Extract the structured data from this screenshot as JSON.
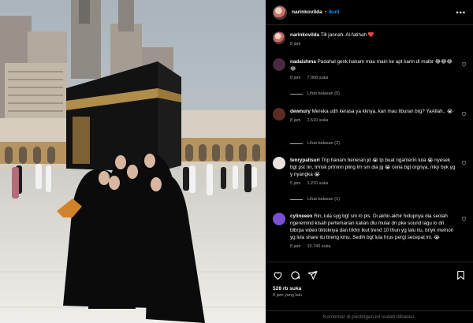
{
  "post": {
    "username": "narinkovilda",
    "follow_label": "Ikuti",
    "separator": "•",
    "more_label": "•••",
    "caption": {
      "username": "narinkovilda",
      "text": "Till jannah. Al-fatihah",
      "emoji": "❤️",
      "time": "8 jam"
    },
    "likes": "528 rb suka",
    "posted": "8 jam yang lalu",
    "comments_disabled": "Komentar di postingan ini sudah dibatasi."
  },
  "comments": [
    {
      "username": "nadaishma",
      "text": "Padahal genk hanam mau main ke apt karin di malbr 😂😂😂😂",
      "time": "8 jam",
      "likes": "7.068 suka",
      "replies": "Lihat balasan (5)",
      "avatar_color": "#4a2a3c"
    },
    {
      "username": "dewnury",
      "text": "Mereka udh kerasa ya kknya, kan mau liburan brg? YaAllah.. 😭",
      "time": "8 jam",
      "likes": "1.510 suka",
      "replies": "Lihat balasan (2)",
      "avatar_color": "#5c2c24"
    },
    {
      "username": "tenrypalisuri",
      "text": "Trip hanam beneran jd 😭 tp buat nganterin lula 😭 nyesek bgt pst rin, trmsk prtmnn pling lm sm dia jg 😭 ceria bgt orgnya, mky byk yg y nyangka 😭",
      "time": "5 jam",
      "likes": "1.210 suka",
      "replies": "Lihat balasan (1)",
      "avatar_color": "#e9e1dc"
    },
    {
      "username": "cylineeex",
      "text": "Rin, lula syg bgt sm lo pls. Di akhir-akhir hidupnya dia seolah ngeremind kisah pertemanan kalian dlu mulai dri pke sound lagu lo dri blbrpa video tiktoknya dan trkhir ikut trend 10 thun yg lalu itu, bnyk memori yg lula share itu breng kmu. Sedih bgt lula hrus pergi secepat ini. 😭",
      "time": "8 jam",
      "likes": "10.740 suka",
      "replies": "",
      "avatar_color": "#7a4fd6"
    }
  ],
  "icons": [
    "more-icon",
    "heart-icon",
    "comment-icon",
    "share-icon",
    "bookmark-icon"
  ],
  "colors": {
    "accent": "#0095f6",
    "background": "#000000",
    "muted": "#a8a8a8"
  }
}
